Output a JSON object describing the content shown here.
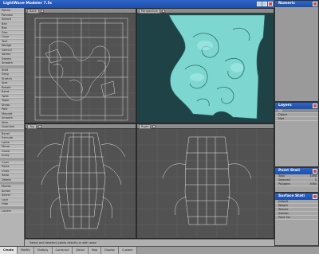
{
  "window": {
    "title": "LightWave Modeler 7.5c"
  },
  "toolbar": {
    "items": [
      "Points",
      "Polygon",
      "Sketch",
      "Ball",
      "Box",
      "Disc",
      "Cone",
      "Text",
      "Wedge",
      "Gemini",
      "Vortex",
      "Sweep",
      "Smooth",
      "",
      "Shift",
      "Drag",
      "Stretch",
      "Size",
      "Rotate",
      "Bend",
      "Twist",
      "Taper",
      "Shear",
      "Pole",
      "Magnet",
      "Smooth",
      "Jitter",
      "Quantize",
      "",
      "Bevel",
      "Extrude",
      "Lathe",
      "Mirror",
      "Clone",
      "Array",
      "",
      "Copy",
      "Paste",
      "Undo",
      "Redo",
      "Delete",
      "",
      "Modes",
      "Action",
      "Select",
      "Lock",
      "Hide",
      "",
      "Layers"
    ]
  },
  "viewports": {
    "top_left": {
      "label": "Back"
    },
    "top_right": {
      "label": "Perspective"
    },
    "bottom_left": {
      "label": "Top"
    },
    "bottom_right": {
      "label": "Right"
    }
  },
  "panels": {
    "numeric": {
      "title": "Numeric"
    },
    "layers": {
      "title": "Layers",
      "rows": [
        "Mn",
        "Object",
        "Mod"
      ]
    },
    "point_stats": {
      "title": "Point Stati",
      "rows": [
        "Total",
        "Selected",
        "Polygons"
      ],
      "values": [
        "3398",
        "0",
        "3064"
      ]
    },
    "surface_stats": {
      "title": "Surface Stati",
      "rows": [
        "Default",
        "Weight",
        "Texture",
        "Subtrac",
        "Point Sel"
      ]
    }
  },
  "statusbar": {
    "text": "Select and deselect points directly or with lasso"
  },
  "tabs": [
    "Create",
    "Modify",
    "Multiply",
    "Construct",
    "Detail",
    "Map",
    "Display",
    "Custom"
  ],
  "active_tab": "Create"
}
